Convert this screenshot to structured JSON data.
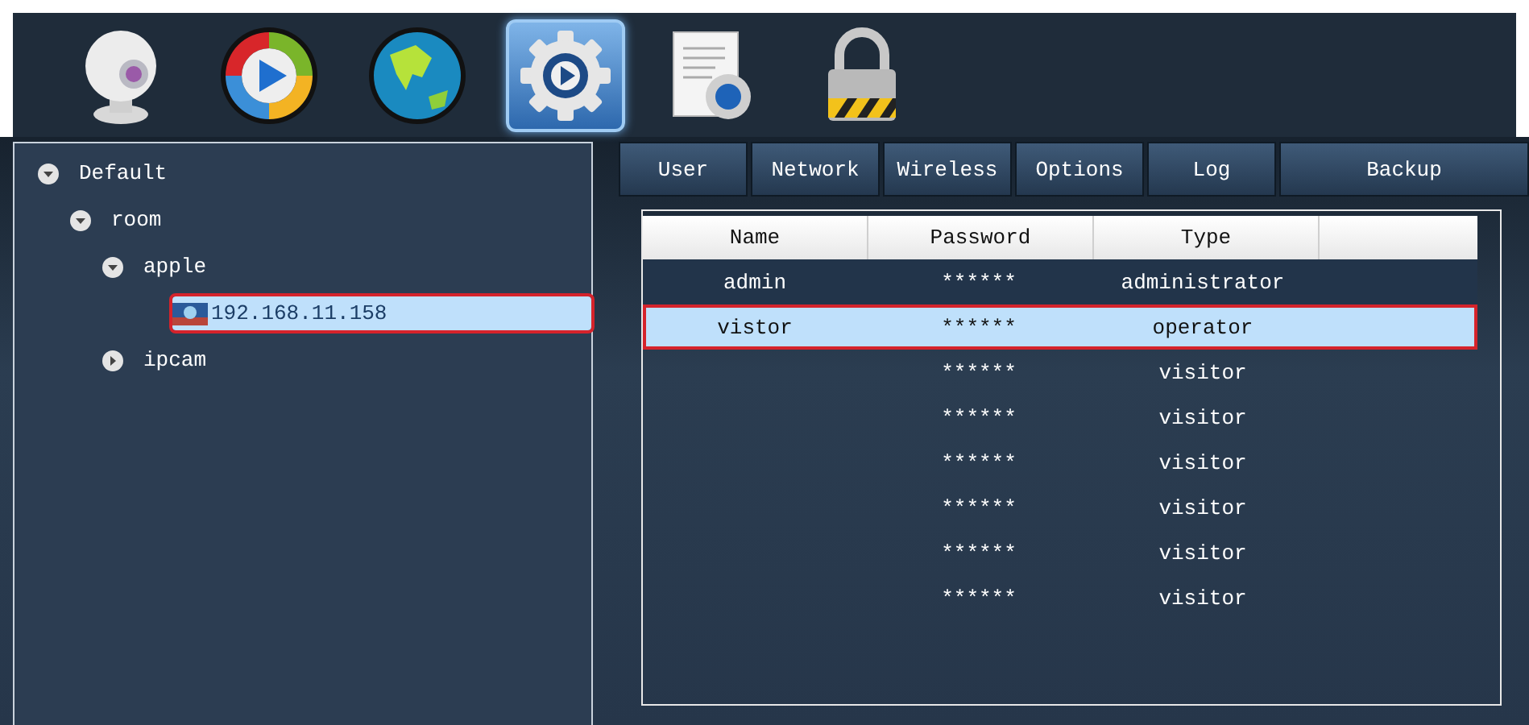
{
  "toolbar": [
    {
      "kind": "webcam",
      "selected": false
    },
    {
      "kind": "player",
      "selected": false
    },
    {
      "kind": "globe",
      "selected": false
    },
    {
      "kind": "settings",
      "selected": true
    },
    {
      "kind": "document",
      "selected": false
    },
    {
      "kind": "lock",
      "selected": false
    }
  ],
  "tree": [
    {
      "label": "Default",
      "kind": "group",
      "expanded": true,
      "selected": false,
      "children": [
        {
          "label": "room",
          "kind": "group",
          "expanded": true,
          "selected": false,
          "children": [
            {
              "label": "apple",
              "kind": "group",
              "expanded": true,
              "selected": false,
              "children": [
                {
                  "label": "192.168.11.158",
                  "kind": "device",
                  "selected": true
                }
              ]
            },
            {
              "label": "ipcam",
              "kind": "group",
              "expanded": false,
              "selected": false
            }
          ]
        }
      ]
    }
  ],
  "tabs": [
    "User",
    "Network",
    "Wireless",
    "Options",
    "Log",
    "Backup"
  ],
  "table": {
    "columns": [
      "Name",
      "Password",
      "Type"
    ],
    "rows": [
      {
        "name": "admin",
        "password": "******",
        "type": "administrator",
        "selected": false
      },
      {
        "name": "vistor",
        "password": "******",
        "type": "operator",
        "selected": true
      },
      {
        "password": "******",
        "type": "visitor",
        "selected": false
      },
      {
        "password": "******",
        "type": "visitor",
        "selected": false
      },
      {
        "password": "******",
        "type": "visitor",
        "selected": false
      },
      {
        "password": "******",
        "type": "visitor",
        "selected": false
      },
      {
        "password": "******",
        "type": "visitor",
        "selected": false
      },
      {
        "password": "******",
        "type": "visitor",
        "selected": false
      }
    ]
  }
}
